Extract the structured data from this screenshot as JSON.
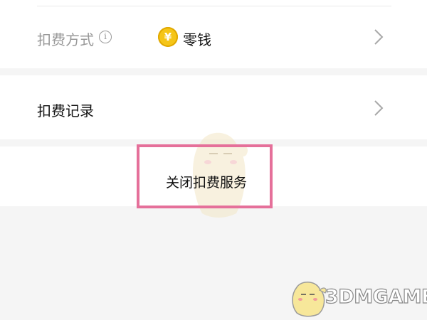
{
  "payment_method": {
    "label": "扣费方式",
    "info_icon_glyph": "i",
    "coin_icon": "yen-coin-icon",
    "coin_glyph": "¥",
    "value": "零钱"
  },
  "records": {
    "label": "扣费记录"
  },
  "actions": {
    "close_service_label": "关闭扣费服务"
  },
  "watermark": {
    "text": "3DMGAME"
  },
  "colors": {
    "highlight_border": "#e5709a",
    "coin": "#f5c518",
    "background": "#f5f5f5"
  }
}
